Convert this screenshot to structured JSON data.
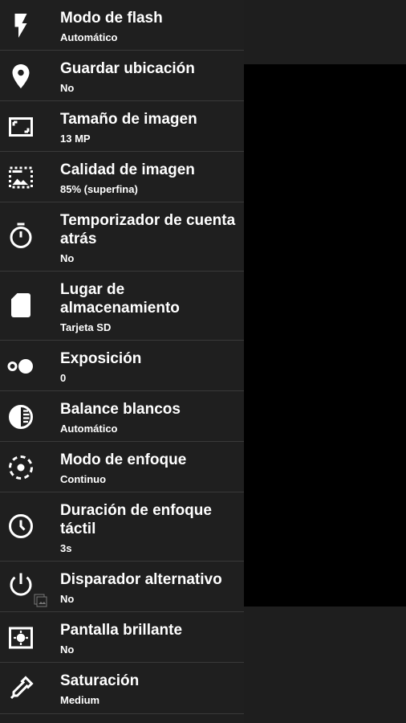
{
  "settings": {
    "items": [
      {
        "title": "Modo de flash",
        "value": "Automático",
        "icon": "flash-icon"
      },
      {
        "title": "Guardar ubicación",
        "value": "No",
        "icon": "location-pin-icon"
      },
      {
        "title": "Tamaño de imagen",
        "value": "13 MP",
        "icon": "image-size-icon"
      },
      {
        "title": "Calidad de imagen",
        "value": "85% (superfina)",
        "icon": "image-quality-icon"
      },
      {
        "title": "Temporizador de cuenta atrás",
        "value": "No",
        "icon": "timer-icon"
      },
      {
        "title": "Lugar de almacenamiento",
        "value": "Tarjeta SD",
        "icon": "sd-card-icon"
      },
      {
        "title": "Exposición",
        "value": "0",
        "icon": "exposure-icon"
      },
      {
        "title": "Balance blancos",
        "value": "Automático",
        "icon": "white-balance-icon"
      },
      {
        "title": "Modo de enfoque",
        "value": "Continuo",
        "icon": "focus-mode-icon"
      },
      {
        "title": "Duración de enfoque táctil",
        "value": "3s",
        "icon": "clock-icon"
      },
      {
        "title": "Disparador alternativo",
        "value": "No",
        "icon": "power-icon"
      },
      {
        "title": "Pantalla brillante",
        "value": "No",
        "icon": "bright-screen-icon"
      },
      {
        "title": "Saturación",
        "value": "Medium",
        "icon": "eyedropper-icon"
      }
    ]
  },
  "colors": {
    "menu_background": "#1f1f1f",
    "divider": "#3a3a3a",
    "text": "#ffffff",
    "viewfinder": "#000000"
  }
}
